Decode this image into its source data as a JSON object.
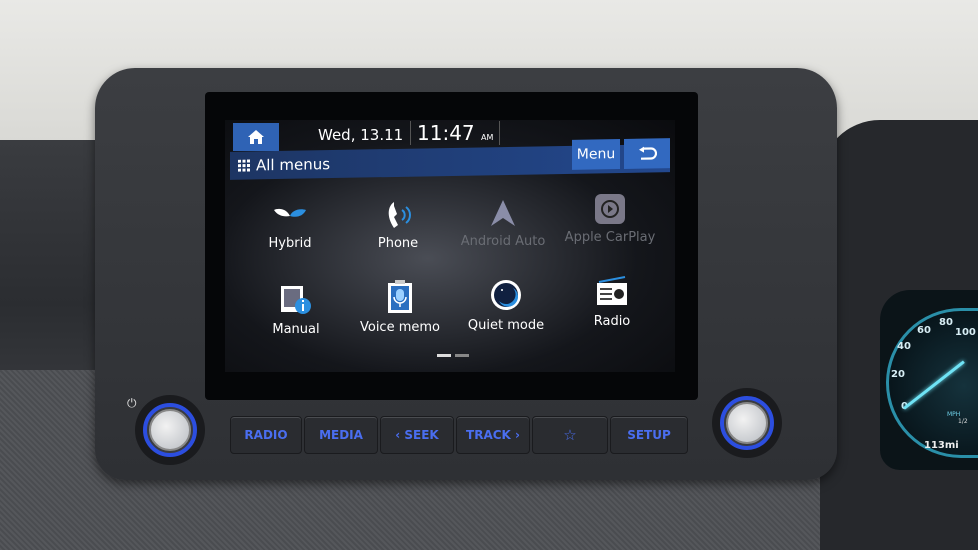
{
  "status_bar": {
    "date": "Wed, 13.11",
    "time": "11:47",
    "ampm": "AM"
  },
  "header": {
    "title": "All menus",
    "menu_label": "Menu",
    "back_icon": "back-arrow-icon",
    "home_icon": "home-icon",
    "grid_icon": "grid-icon"
  },
  "apps": [
    {
      "label": "Hybrid",
      "icon": "leaf-icon",
      "enabled": true
    },
    {
      "label": "Phone",
      "icon": "phone-icon",
      "enabled": true
    },
    {
      "label": "Android Auto",
      "icon": "android-auto-icon",
      "enabled": false
    },
    {
      "label": "Apple CarPlay",
      "icon": "carplay-icon",
      "enabled": false
    },
    {
      "label": "Manual",
      "icon": "manual-icon",
      "enabled": true
    },
    {
      "label": "Voice memo",
      "icon": "voice-memo-icon",
      "enabled": true
    },
    {
      "label": "Quiet mode",
      "icon": "moon-icon",
      "enabled": true
    },
    {
      "label": "Radio",
      "icon": "radio-icon",
      "enabled": true
    }
  ],
  "pagination": {
    "current": 1,
    "total": 2
  },
  "hard_keys": [
    "RADIO",
    "MEDIA",
    "‹ SEEK",
    "TRACK ›",
    "☆",
    "SETUP"
  ],
  "cluster": {
    "ticks": [
      "0",
      "20",
      "40",
      "60",
      "80",
      "100"
    ],
    "unit": "MPH",
    "fuel": "1/2",
    "range": "113mi"
  },
  "colors": {
    "accent": "#3269c0",
    "keys": "#4a6ef0",
    "knob_ring": "#2c4ee0"
  }
}
